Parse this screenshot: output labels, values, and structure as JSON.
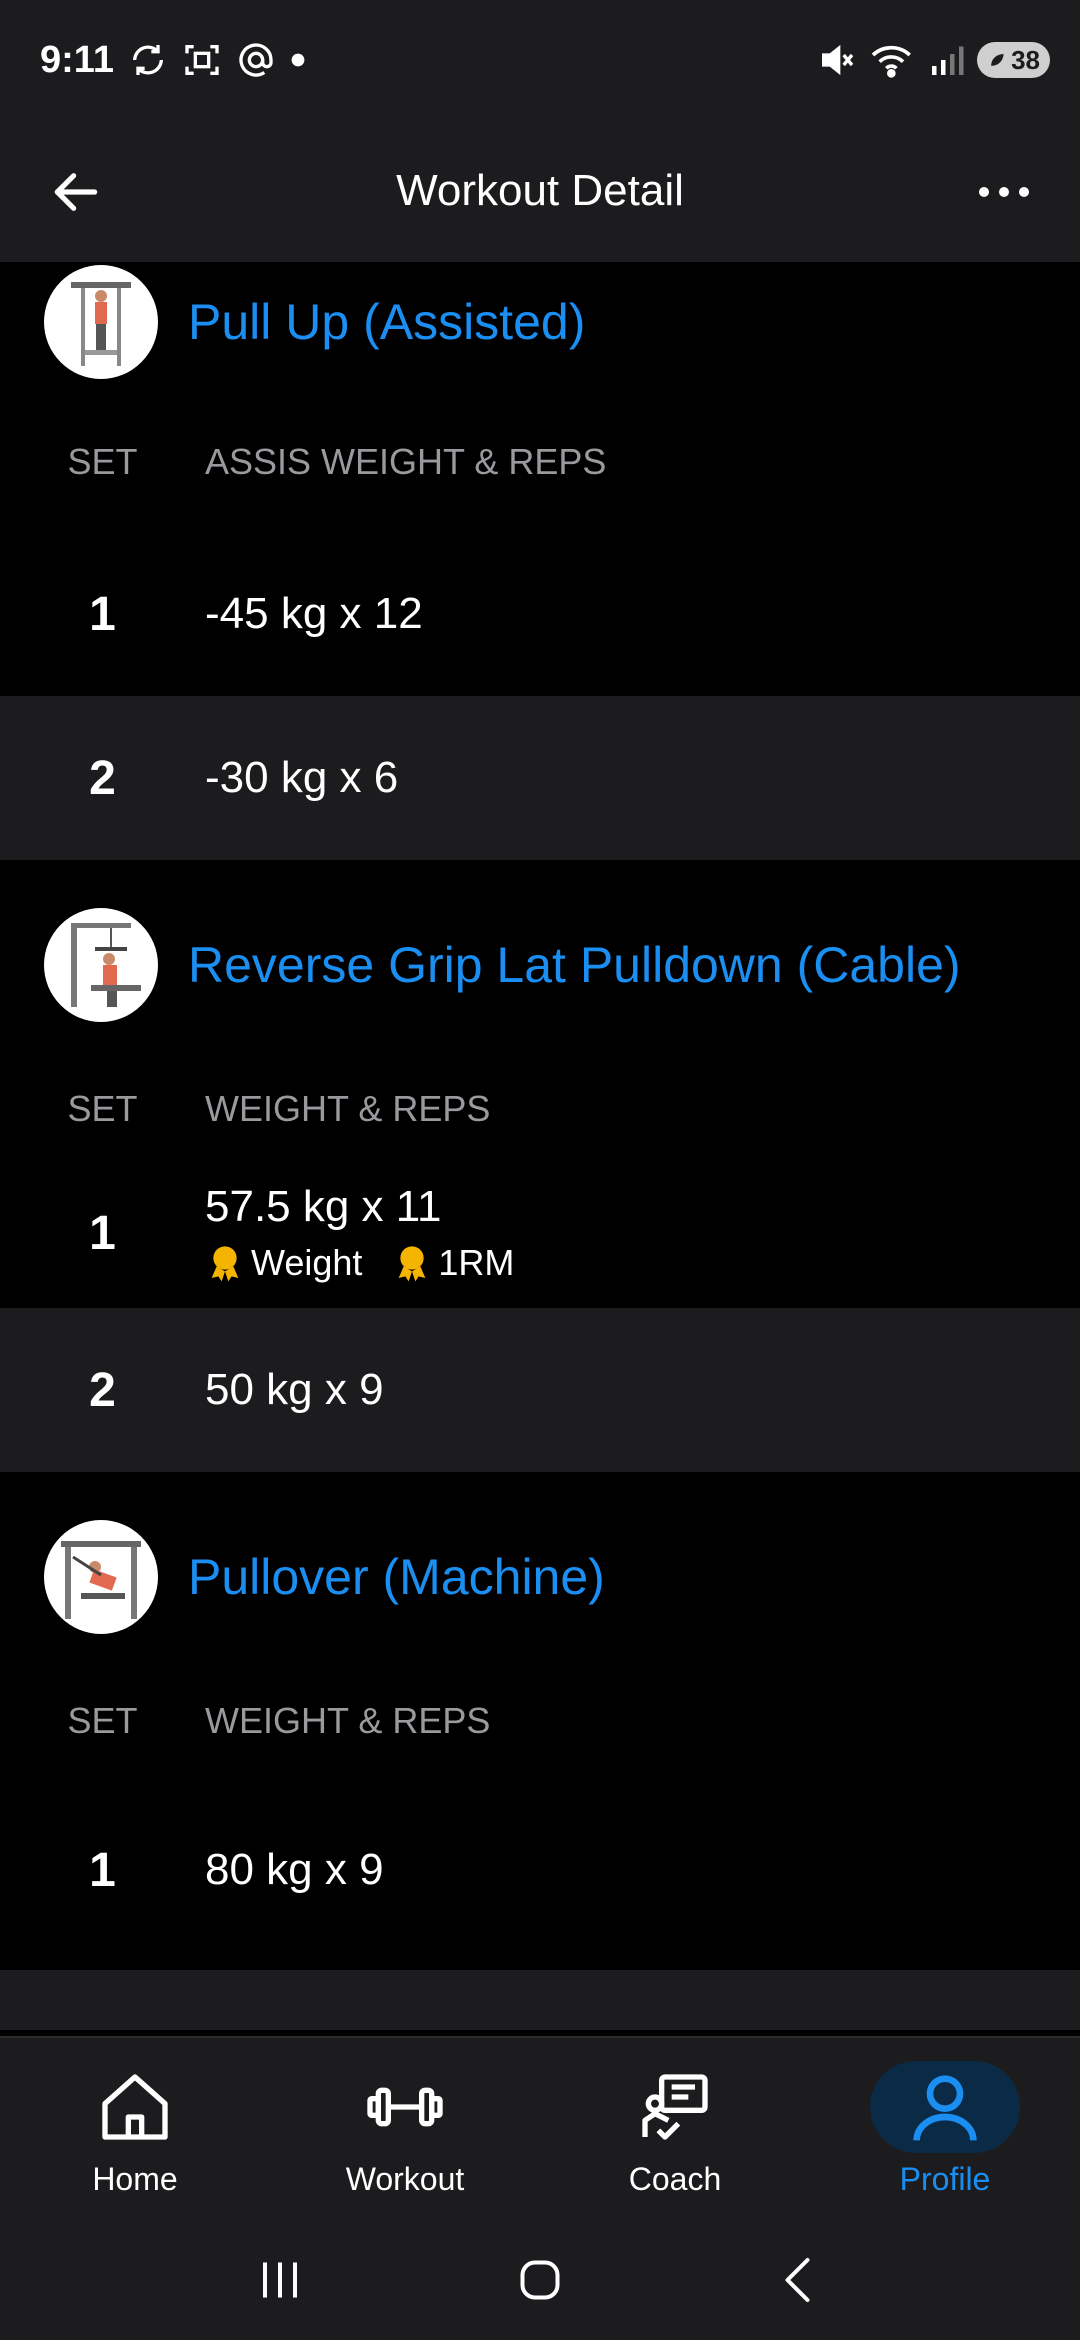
{
  "status_bar": {
    "time": "9:11",
    "battery": "38"
  },
  "app_bar": {
    "title": "Workout Detail"
  },
  "exercises": [
    {
      "name": "Pull Up (Assisted)",
      "col_set": "SET",
      "col_value": "ASSIS WEIGHT & REPS",
      "sets": [
        {
          "num": "1",
          "value": "-45 kg x 12"
        },
        {
          "num": "2",
          "value": "-30 kg x 6"
        }
      ]
    },
    {
      "name": "Reverse Grip Lat Pulldown (Cable)",
      "col_set": "SET",
      "col_value": "WEIGHT & REPS",
      "sets": [
        {
          "num": "1",
          "value": "57.5 kg x 11",
          "pr_weight": "Weight",
          "pr_1rm": "1RM"
        },
        {
          "num": "2",
          "value": "50 kg x 9"
        }
      ]
    },
    {
      "name": "Pullover (Machine)",
      "col_set": "SET",
      "col_value": "WEIGHT & REPS",
      "sets": [
        {
          "num": "1",
          "value": "80 kg x 9"
        }
      ]
    }
  ],
  "bottom_nav": {
    "home": "Home",
    "workout": "Workout",
    "coach": "Coach",
    "profile": "Profile"
  },
  "colors": {
    "accent": "#1b8ef2",
    "surface": "#1c1c1e",
    "background": "#000000",
    "medal": "#f5b400"
  }
}
